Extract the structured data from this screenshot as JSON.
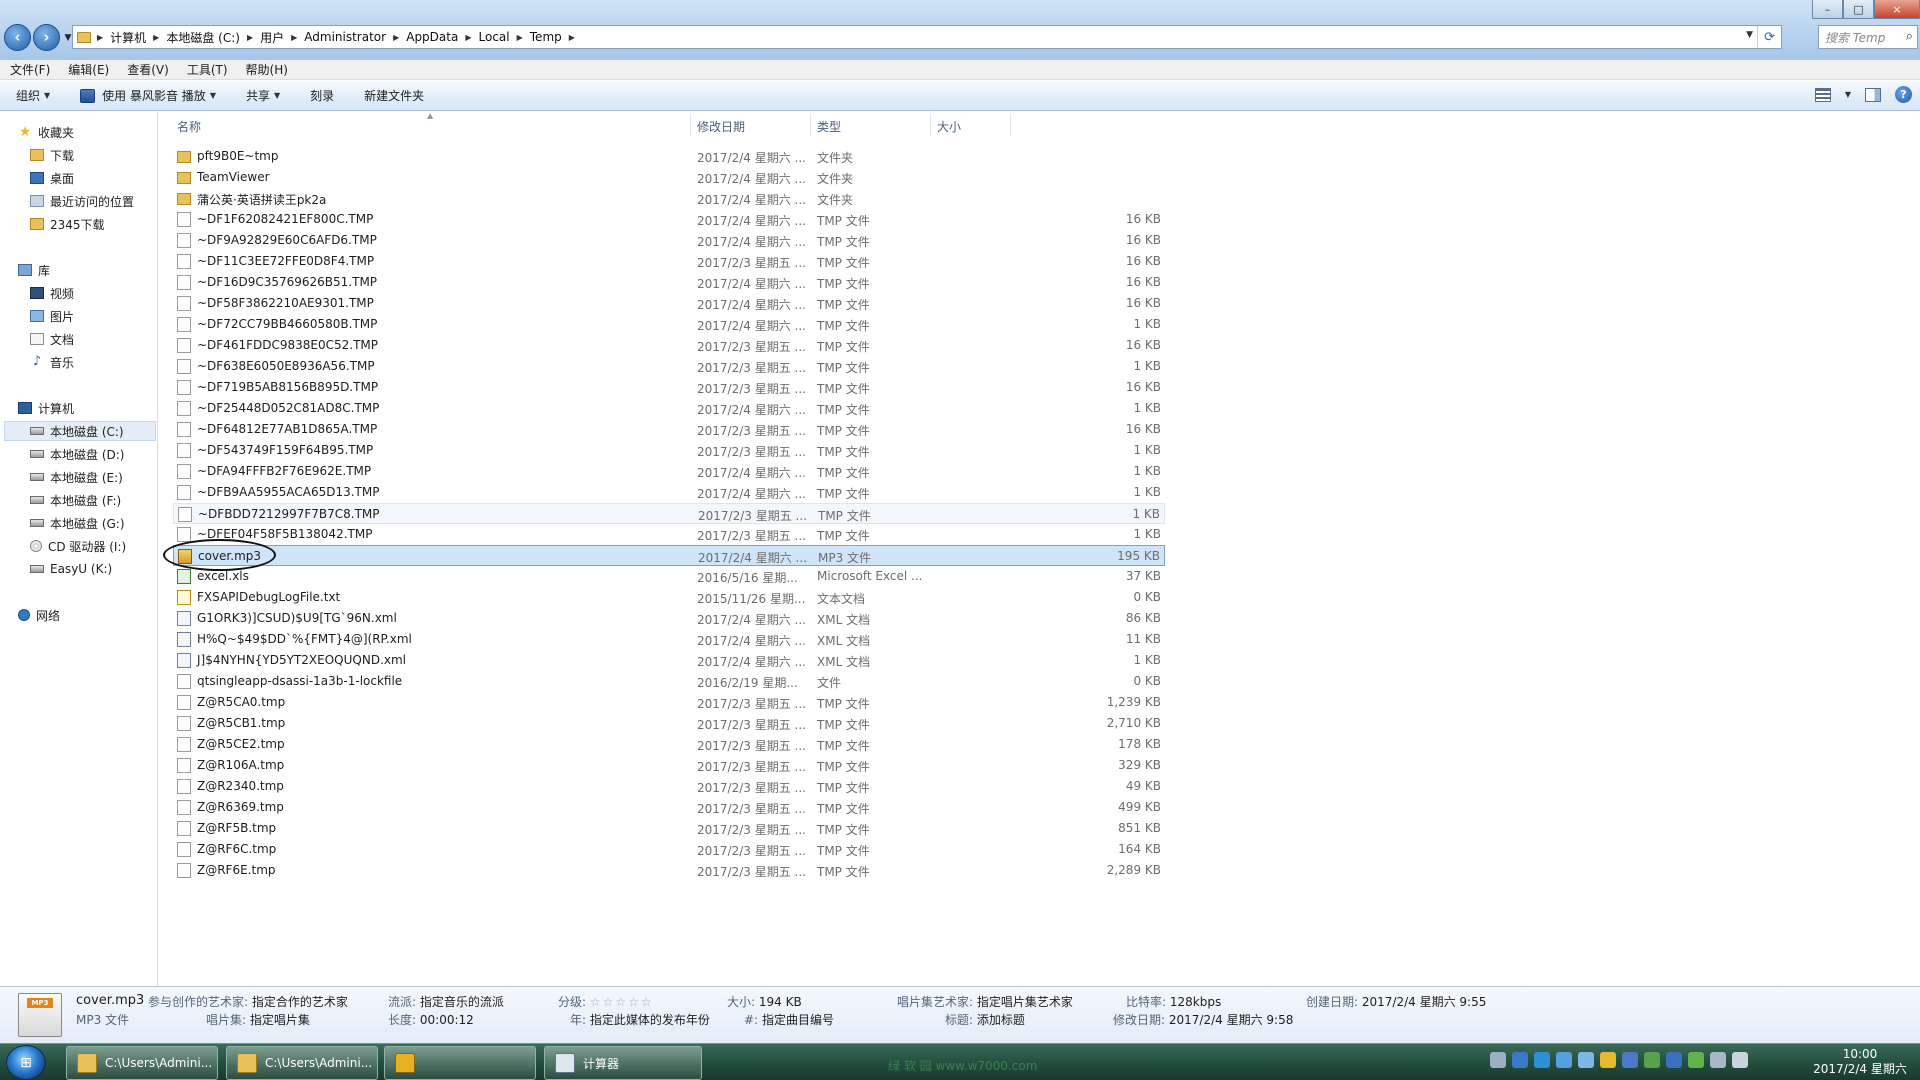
{
  "window": {
    "minimize_label": "–",
    "maximize_label": "□",
    "close_label": "×"
  },
  "address": {
    "crumbs": [
      "计算机",
      "本地磁盘 (C:)",
      "用户",
      "Administrator",
      "AppData",
      "Local",
      "Temp"
    ],
    "search_placeholder": "搜索 Temp"
  },
  "menu": [
    "文件(F)",
    "编辑(E)",
    "查看(V)",
    "工具(T)",
    "帮助(H)"
  ],
  "commands": {
    "organize": "组织",
    "play": "使用 暴风影音 播放",
    "share": "共享",
    "burn": "刻录",
    "new_folder": "新建文件夹"
  },
  "sidebar": {
    "favorites": "收藏夹",
    "downloads": "下载",
    "desktop": "桌面",
    "recent": "最近访问的位置",
    "dl2345": "2345下载",
    "libraries": "库",
    "videos": "视频",
    "pictures": "图片",
    "documents": "文档",
    "music": "音乐",
    "computer": "计算机",
    "drive_c": "本地磁盘 (C:)",
    "drive_d": "本地磁盘 (D:)",
    "drive_e": "本地磁盘 (E:)",
    "drive_f": "本地磁盘 (F:)",
    "drive_g": "本地磁盘 (G:)",
    "drive_i": "CD 驱动器 (I:)",
    "drive_k": "EasyU (K:)",
    "network": "网络"
  },
  "columns": {
    "name": "名称",
    "modified": "修改日期",
    "type": "类型",
    "size": "大小"
  },
  "files": [
    {
      "name": "pft9B0E~tmp",
      "date": "2017/2/4 星期六 ...",
      "type": "文件夹",
      "size": "",
      "icon": "folder"
    },
    {
      "name": "TeamViewer",
      "date": "2017/2/4 星期六 ...",
      "type": "文件夹",
      "size": "",
      "icon": "folder"
    },
    {
      "name": "蒲公英·英语拼读王pk2a",
      "date": "2017/2/4 星期六 ...",
      "type": "文件夹",
      "size": "",
      "icon": "folder"
    },
    {
      "name": "~DF1F62082421EF800C.TMP",
      "date": "2017/2/4 星期六 ...",
      "type": "TMP 文件",
      "size": "16 KB",
      "icon": "file"
    },
    {
      "name": "~DF9A92829E60C6AFD6.TMP",
      "date": "2017/2/4 星期六 ...",
      "type": "TMP 文件",
      "size": "16 KB",
      "icon": "file"
    },
    {
      "name": "~DF11C3EE72FFE0D8F4.TMP",
      "date": "2017/2/3 星期五 ...",
      "type": "TMP 文件",
      "size": "16 KB",
      "icon": "file"
    },
    {
      "name": "~DF16D9C35769626B51.TMP",
      "date": "2017/2/4 星期六 ...",
      "type": "TMP 文件",
      "size": "16 KB",
      "icon": "file"
    },
    {
      "name": "~DF58F3862210AE9301.TMP",
      "date": "2017/2/4 星期六 ...",
      "type": "TMP 文件",
      "size": "16 KB",
      "icon": "file"
    },
    {
      "name": "~DF72CC79BB4660580B.TMP",
      "date": "2017/2/4 星期六 ...",
      "type": "TMP 文件",
      "size": "1 KB",
      "icon": "file"
    },
    {
      "name": "~DF461FDDC9838E0C52.TMP",
      "date": "2017/2/3 星期五 ...",
      "type": "TMP 文件",
      "size": "16 KB",
      "icon": "file"
    },
    {
      "name": "~DF638E6050E8936A56.TMP",
      "date": "2017/2/3 星期五 ...",
      "type": "TMP 文件",
      "size": "1 KB",
      "icon": "file"
    },
    {
      "name": "~DF719B5AB8156B895D.TMP",
      "date": "2017/2/3 星期五 ...",
      "type": "TMP 文件",
      "size": "16 KB",
      "icon": "file"
    },
    {
      "name": "~DF25448D052C81AD8C.TMP",
      "date": "2017/2/4 星期六 ...",
      "type": "TMP 文件",
      "size": "1 KB",
      "icon": "file"
    },
    {
      "name": "~DF64812E77AB1D865A.TMP",
      "date": "2017/2/3 星期五 ...",
      "type": "TMP 文件",
      "size": "16 KB",
      "icon": "file"
    },
    {
      "name": "~DF543749F159F64B95.TMP",
      "date": "2017/2/3 星期五 ...",
      "type": "TMP 文件",
      "size": "1 KB",
      "icon": "file"
    },
    {
      "name": "~DFA94FFFB2F76E962E.TMP",
      "date": "2017/2/4 星期六 ...",
      "type": "TMP 文件",
      "size": "1 KB",
      "icon": "file"
    },
    {
      "name": "~DFB9AA5955ACA65D13.TMP",
      "date": "2017/2/4 星期六 ...",
      "type": "TMP 文件",
      "size": "1 KB",
      "icon": "file"
    },
    {
      "name": "~DFBDD7212997F7B7C8.TMP",
      "date": "2017/2/3 星期五 ...",
      "type": "TMP 文件",
      "size": "1 KB",
      "icon": "file"
    },
    {
      "name": "~DFEF04F58F5B138042.TMP",
      "date": "2017/2/3 星期五 ...",
      "type": "TMP 文件",
      "size": "1 KB",
      "icon": "file"
    },
    {
      "name": "cover.mp3",
      "date": "2017/2/4 星期六 ...",
      "type": "MP3 文件",
      "size": "195 KB",
      "icon": "mp3"
    },
    {
      "name": "excel.xls",
      "date": "2016/5/16 星期...",
      "type": "Microsoft Excel ...",
      "size": "37 KB",
      "icon": "xls"
    },
    {
      "name": "FXSAPIDebugLogFile.txt",
      "date": "2015/11/26 星期...",
      "type": "文本文档",
      "size": "0 KB",
      "icon": "txt"
    },
    {
      "name": "G1ORK3)]CSUD)$U9[TG`96N.xml",
      "date": "2017/2/4 星期六 ...",
      "type": "XML 文档",
      "size": "86 KB",
      "icon": "xml"
    },
    {
      "name": "H%Q~$49$DD`%{FMT}4@](RP.xml",
      "date": "2017/2/4 星期六 ...",
      "type": "XML 文档",
      "size": "11 KB",
      "icon": "xml"
    },
    {
      "name": "J]$4NYHN{YD5YT2XEOQUQND.xml",
      "date": "2017/2/4 星期六 ...",
      "type": "XML 文档",
      "size": "1 KB",
      "icon": "xml"
    },
    {
      "name": "qtsingleapp-dsassi-1a3b-1-lockfile",
      "date": "2016/2/19 星期...",
      "type": "文件",
      "size": "0 KB",
      "icon": "file"
    },
    {
      "name": "Z@R5CA0.tmp",
      "date": "2017/2/3 星期五 ...",
      "type": "TMP 文件",
      "size": "1,239 KB",
      "icon": "file"
    },
    {
      "name": "Z@R5CB1.tmp",
      "date": "2017/2/3 星期五 ...",
      "type": "TMP 文件",
      "size": "2,710 KB",
      "icon": "file"
    },
    {
      "name": "Z@R5CE2.tmp",
      "date": "2017/2/3 星期五 ...",
      "type": "TMP 文件",
      "size": "178 KB",
      "icon": "file"
    },
    {
      "name": "Z@R106A.tmp",
      "date": "2017/2/3 星期五 ...",
      "type": "TMP 文件",
      "size": "329 KB",
      "icon": "file"
    },
    {
      "name": "Z@R2340.tmp",
      "date": "2017/2/3 星期五 ...",
      "type": "TMP 文件",
      "size": "49 KB",
      "icon": "file"
    },
    {
      "name": "Z@R6369.tmp",
      "date": "2017/2/3 星期五 ...",
      "type": "TMP 文件",
      "size": "499 KB",
      "icon": "file"
    },
    {
      "name": "Z@RF5B.tmp",
      "date": "2017/2/3 星期五 ...",
      "type": "TMP 文件",
      "size": "851 KB",
      "icon": "file"
    },
    {
      "name": "Z@RF6C.tmp",
      "date": "2017/2/3 星期五 ...",
      "type": "TMP 文件",
      "size": "164 KB",
      "icon": "file"
    },
    {
      "name": "Z@RF6E.tmp",
      "date": "2017/2/3 星期五 ...",
      "type": "TMP 文件",
      "size": "2,289 KB",
      "icon": "file"
    }
  ],
  "hover_index": 17,
  "selected_index": 19,
  "details": {
    "filename": "cover.mp3",
    "filetype": "MP3 文件",
    "contributing_artist_k": "参与创作的艺术家:",
    "contributing_artist_v": "指定合作的艺术家",
    "album_k": "唱片集:",
    "album_v": "指定唱片集",
    "genre_k": "流派:",
    "genre_v": "指定音乐的流派",
    "length_k": "长度:",
    "length_v": "00:00:12",
    "rating_k": "分级:",
    "rating_stars": "☆☆☆☆☆",
    "year_k": "年:",
    "year_v": "指定此媒体的发布年份",
    "size_k": "大小:",
    "size_v": "194 KB",
    "track_k": "#:",
    "track_v": "指定曲目编号",
    "album_artist_k": "唱片集艺术家:",
    "album_artist_v": "指定唱片集艺术家",
    "title_k": "标题:",
    "title_v": "添加标题",
    "bitrate_k": "比特率:",
    "bitrate_v": "128kbps",
    "modified_k": "修改日期:",
    "modified_v": "2017/2/4 星期六 9:58",
    "created_k": "创建日期:",
    "created_v": "2017/2/4 星期六 9:55",
    "thumb_tag": "MP3"
  },
  "taskbar": {
    "tasks": [
      "C:\\Users\\Admini...",
      "C:\\Users\\Admini...",
      "",
      "计算器"
    ],
    "time": "10:00",
    "date": "2017/2/4 星期六",
    "watermark": "绿 软 园  www.w7000.com"
  },
  "colors": {
    "accent": "#2d6ab0",
    "selection": "#cfe3f9",
    "taskbar": "#24503f"
  }
}
